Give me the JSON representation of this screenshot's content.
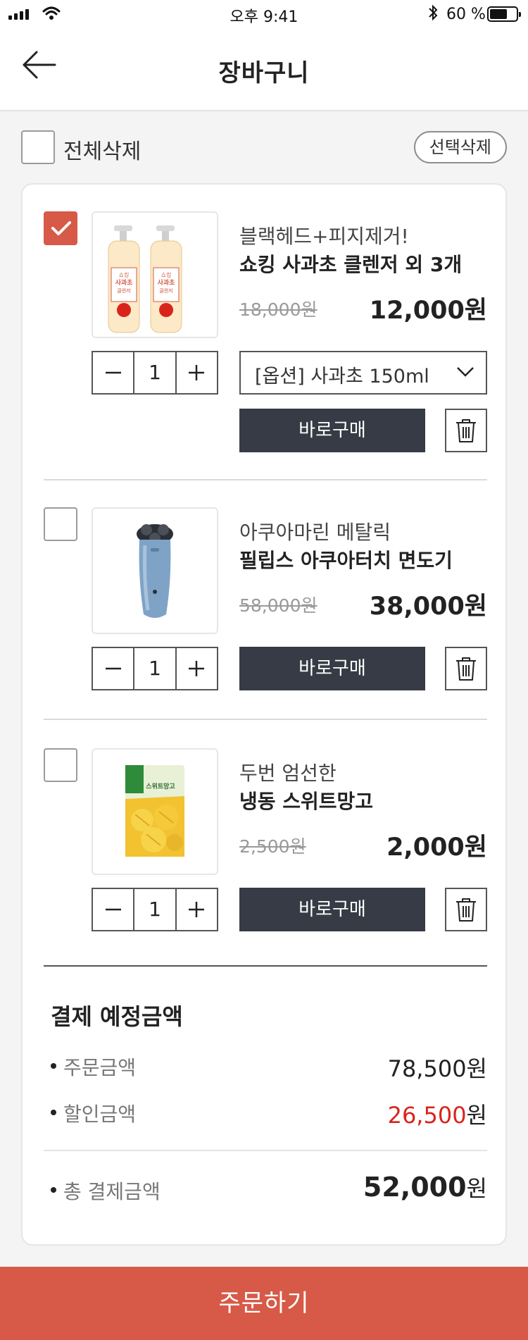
{
  "status_bar": {
    "time": "오후 9:41",
    "battery": "60 %",
    "battery_level": 0.6
  },
  "header": {
    "title": "장바구니"
  },
  "select_bar": {
    "select_all_label": "전체삭제",
    "delete_selected_label": "선택삭제"
  },
  "items": [
    {
      "checked": true,
      "brand": "블랙헤드+피지제거!",
      "name": "쇼킹 사과초 클렌저 외 3개",
      "original_price": "18,000원",
      "price": "12,000원",
      "quantity": "1",
      "option": "[옵션] 사과초 150ml",
      "buy_label": "바로구매",
      "image_labels": [
        "쇼킹",
        "사과초",
        "클렌저"
      ]
    },
    {
      "checked": false,
      "brand": "아쿠아마린 메탈릭",
      "name": "필립스 아쿠아터치 면도기",
      "original_price": "58,000원",
      "price": "38,000원",
      "quantity": "1",
      "buy_label": "바로구매"
    },
    {
      "checked": false,
      "brand": "두번 엄선한",
      "name": "냉동 스위트망고",
      "original_price": "2,500원",
      "price": "2,000원",
      "quantity": "1",
      "buy_label": "바로구매",
      "image_labels": [
        "스위트망고"
      ]
    }
  ],
  "summary": {
    "title": "결제 예정금액",
    "order_amount_label": "주문금액",
    "order_amount": "78,500",
    "discount_label": "할인금액",
    "discount": "26,500",
    "total_label": "총 결제금액",
    "total": "52,000",
    "currency": "원"
  },
  "order_button": "주문하기",
  "colors": {
    "accent": "#d65a47",
    "dark_button": "#373b45",
    "discount_red": "#d9241c"
  }
}
